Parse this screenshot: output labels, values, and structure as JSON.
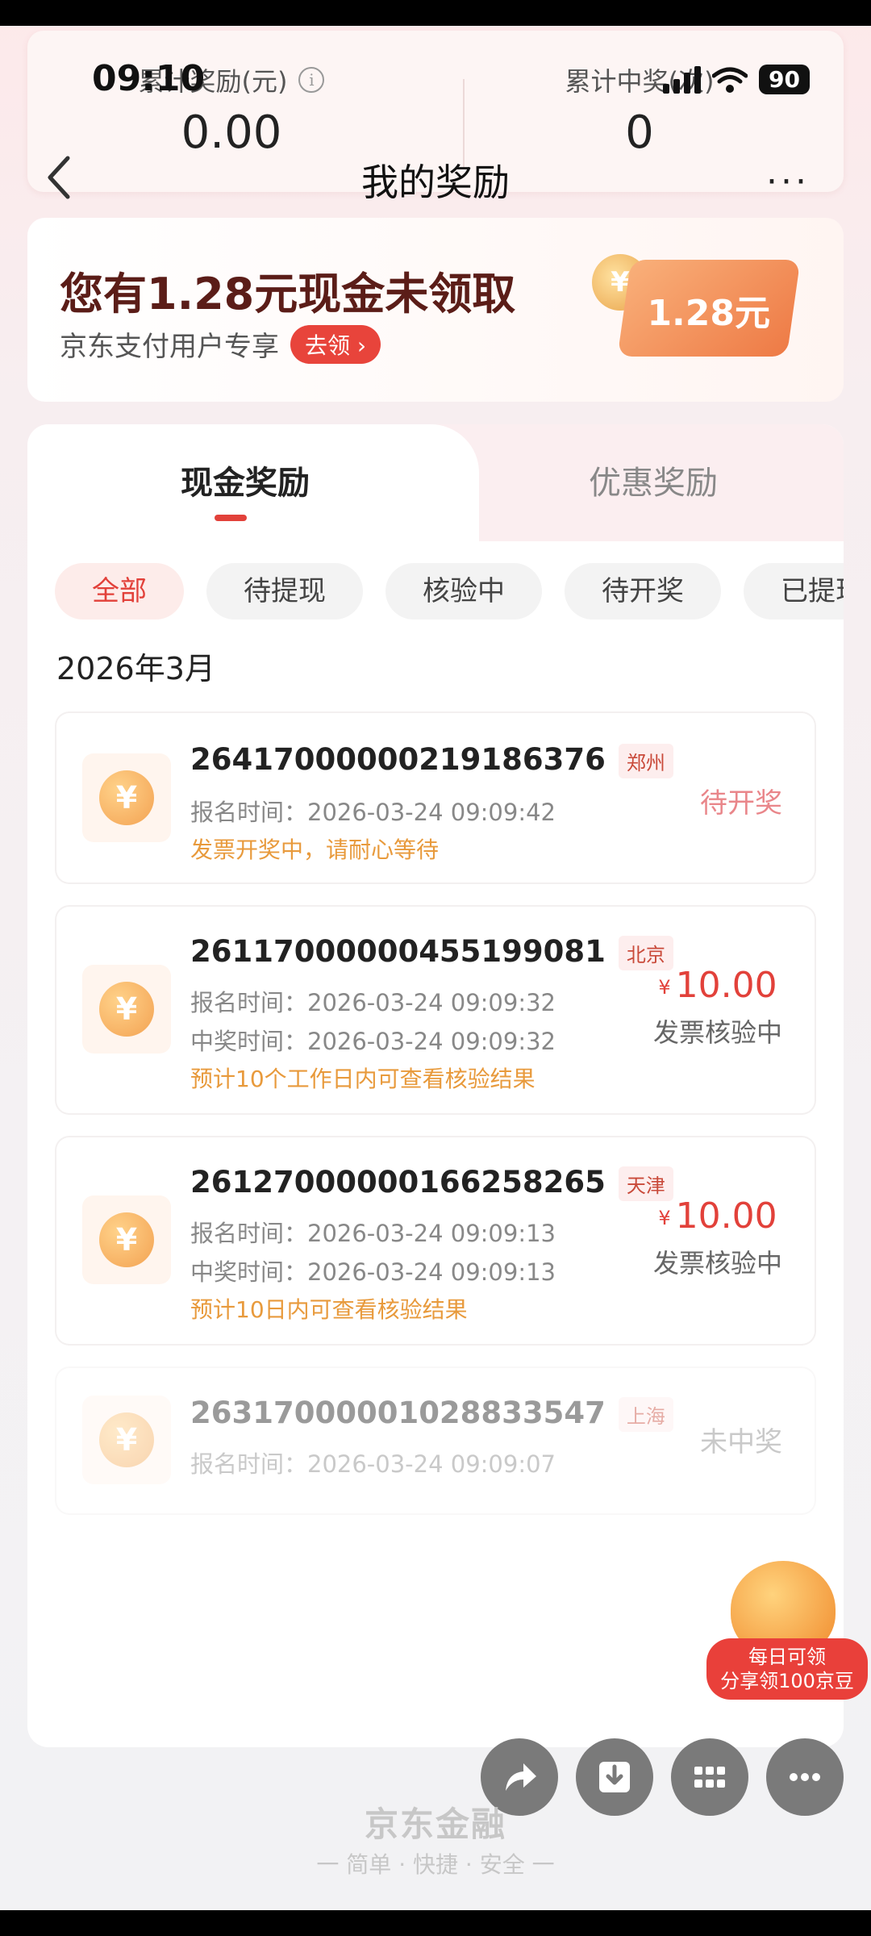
{
  "status_bar": {
    "time": "09:10",
    "battery": "90"
  },
  "stats": {
    "left": {
      "label": "累计奖励(元)",
      "value": "0.00"
    },
    "right": {
      "label": "累计中奖(次)",
      "value": "0"
    }
  },
  "nav": {
    "title": "我的奖励",
    "more": "···"
  },
  "banner": {
    "title": "您有1.28元现金未领取",
    "subtitle": "京东支付用户专享",
    "claim_label": "去领 ›",
    "coupon_text": "1.28元"
  },
  "tabs": [
    {
      "label": "现金奖励"
    },
    {
      "label": "优惠奖励"
    }
  ],
  "filters": [
    {
      "label": "全部"
    },
    {
      "label": "待提现"
    },
    {
      "label": "核验中"
    },
    {
      "label": "待开奖"
    },
    {
      "label": "已提现"
    }
  ],
  "month": "2026年3月",
  "entries": [
    {
      "id": "26417000000219186376",
      "city": "郑州",
      "lines": [
        "报名时间：2026-03-24 09:09:42"
      ],
      "note": "发票开奖中，请耐心等待",
      "status": "待开奖"
    },
    {
      "id": "26117000000455199081",
      "city": "北京",
      "lines": [
        "报名时间：2026-03-24 09:09:32",
        "中奖时间：2026-03-24 09:09:32"
      ],
      "note": "预计10个工作日内可查看核验结果",
      "currency": "¥",
      "amount": "10.00",
      "status": "发票核验中"
    },
    {
      "id": "26127000000166258265",
      "city": "天津",
      "lines": [
        "报名时间：2026-03-24 09:09:13",
        "中奖时间：2026-03-24 09:09:13"
      ],
      "note": "预计10日内可查看核验结果",
      "currency": "¥",
      "amount": "10.00",
      "status": "发票核验中"
    },
    {
      "id": "26317000001028833547",
      "city": "上海",
      "lines": [
        "报名时间：2026-03-24 09:09:07"
      ],
      "status": "未中奖"
    }
  ],
  "promo": {
    "line1": "每日可领",
    "line2": "分享领100京豆"
  },
  "footer": {
    "brand": "京东金融",
    "slogan": "一 简单 · 快捷 · 安全 一"
  },
  "icons": [
    "share-icon",
    "download-icon",
    "grid-icon",
    "more-icon"
  ]
}
